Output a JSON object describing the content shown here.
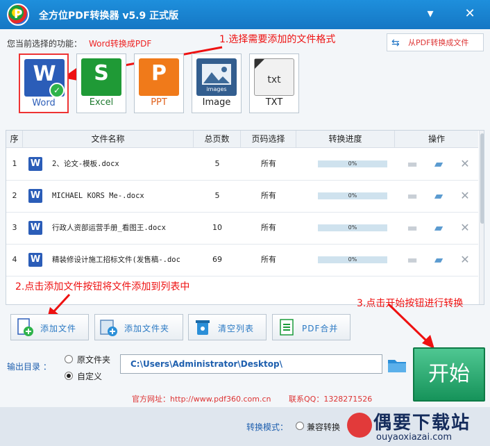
{
  "titlebar": {
    "logo_letter": "P",
    "title": "全方位PDF转换器 v5.9 正式版",
    "minimize_glyph": "▾",
    "close_glyph": "✕"
  },
  "function": {
    "label": "您当前选择的功能：",
    "value": "Word转换成PDF"
  },
  "from_pdf": {
    "label": "从PDF转换成文件",
    "icon_glyph": "⇆"
  },
  "annotations": {
    "a1": "1.选择需要添加的文件格式",
    "a2": "2.点击添加文件按钮将文件添加到列表中",
    "a3": "3.点击开始按钮进行转换"
  },
  "formats": [
    {
      "label": "Word",
      "glyph": "W",
      "color": "#2b5db8",
      "selected": true
    },
    {
      "label": "Excel",
      "glyph": "S",
      "color": "#1f9a36",
      "selected": false
    },
    {
      "label": "PPT",
      "glyph": "P",
      "color": "#f07a1a",
      "selected": false
    },
    {
      "label": "Image",
      "glyph": "images",
      "color": "#335e8f",
      "selected": false
    },
    {
      "label": "TXT",
      "glyph": "txt",
      "color": "#f1f1f1",
      "selected": false
    }
  ],
  "table": {
    "headers": [
      "序",
      "文件名称",
      "总页数",
      "页码选择",
      "转换进度",
      "操作"
    ],
    "rows": [
      {
        "no": "1",
        "name": "2、论文-模板.docx",
        "pages": "5",
        "range": "所有",
        "progress": 0,
        "progress_text": "0%"
      },
      {
        "no": "2",
        "name": "MICHAEL KORS Me-.docx",
        "pages": "5",
        "range": "所有",
        "progress": 0,
        "progress_text": "0%"
      },
      {
        "no": "3",
        "name": "行政人资部运营手册_看图王.docx",
        "pages": "10",
        "range": "所有",
        "progress": 0,
        "progress_text": "0%"
      },
      {
        "no": "4",
        "name": "精装修设计施工招标文件(发售稿-.doc",
        "pages": "69",
        "range": "所有",
        "progress": 0,
        "progress_text": "0%"
      }
    ],
    "row_icon_glyph": "W"
  },
  "buttons": {
    "add_file": "添加文件",
    "add_folder": "添加文件夹",
    "clear_list": "清空列表",
    "pdf_merge": "PDF合并"
  },
  "output": {
    "label": "输出目录 ：",
    "opt_source": "原文件夹",
    "opt_custom": "自定义",
    "path": "C:\\Users\\Administrator\\Desktop\\"
  },
  "start_label": "开始",
  "site": "官方网址：http://www.pdf360.com.cn",
  "qq": "联系QQ：1328271526",
  "mode": {
    "label": "转换模式：",
    "opt1": "兼容转换"
  },
  "watermark": {
    "big": "偶要下载站",
    "small": "ouyaoxiazai.com"
  },
  "colors": {
    "title_bar": "#1a84d2",
    "accent": "#1e5fae",
    "annotation": "#e11111",
    "start": "#1d9c60"
  }
}
